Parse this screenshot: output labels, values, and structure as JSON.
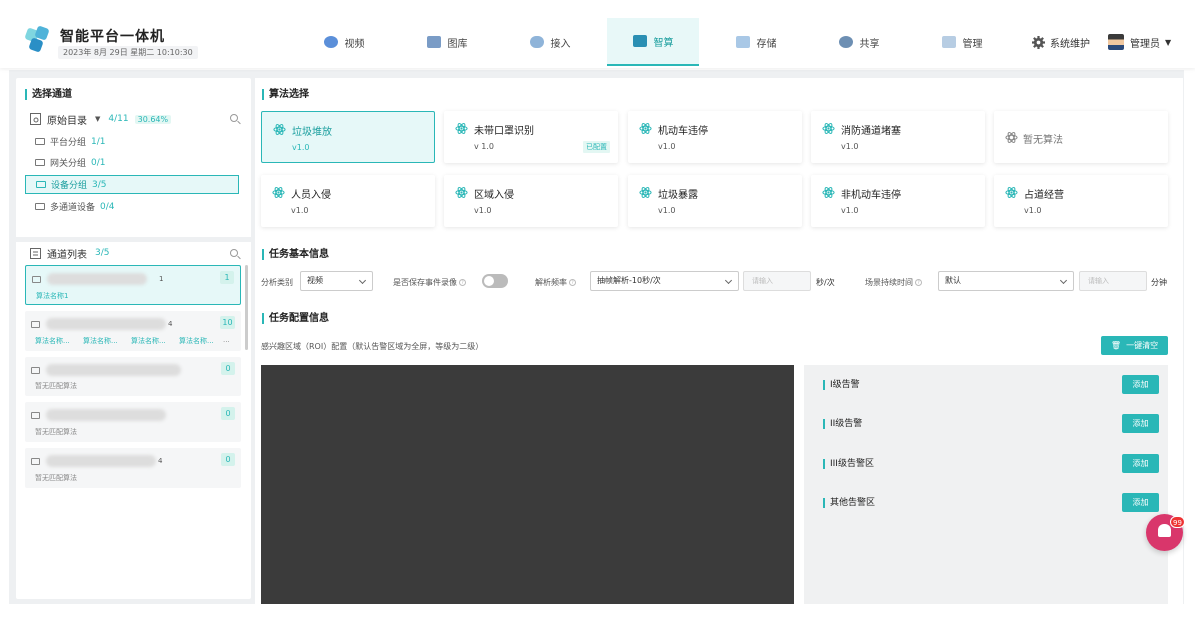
{
  "app": {
    "title": "智能平台一体机",
    "datetime": "2023年 8月 29日  星期二  10:10:30"
  },
  "nav": [
    {
      "label": "视频",
      "icon": "video-icon",
      "color": "#5b8fd9"
    },
    {
      "label": "图库",
      "icon": "gallery-icon",
      "color": "#7a9cc6"
    },
    {
      "label": "接入",
      "icon": "access-icon",
      "color": "#8fb4d9"
    },
    {
      "label": "智算",
      "icon": "compute-icon",
      "color": "#2ab7b7"
    },
    {
      "label": "存储",
      "icon": "storage-icon",
      "color": "#a9c8e6"
    },
    {
      "label": "共享",
      "icon": "share-icon",
      "color": "#6d8fb3"
    },
    {
      "label": "管理",
      "icon": "manage-icon",
      "color": "#b7cde3"
    }
  ],
  "header": {
    "sysmaint": "系统维护",
    "admin": "管理员"
  },
  "left": {
    "title": "选择通道",
    "root": {
      "label": "原始目录",
      "count": "4/11",
      "pct": "30.64%"
    },
    "groups": [
      {
        "label": "平台分组",
        "count": "1/1"
      },
      {
        "label": "网关分组",
        "count": "0/1"
      },
      {
        "label": "设备分组",
        "count": "3/5"
      },
      {
        "label": "多通道设备",
        "count": "0/4"
      }
    ],
    "list_title": "通道列表",
    "list_count": "3/5",
    "channels": [
      {
        "suffix": "1",
        "badge": "1",
        "sub": "算法名称1"
      },
      {
        "suffix": "4",
        "badge": "10",
        "tags": [
          "算法名称...",
          "算法名称...",
          "算法名称...",
          "算法名称...",
          "..."
        ]
      },
      {
        "suffix": "",
        "badge": "0",
        "sub": "暂无匹配算法"
      },
      {
        "suffix": "",
        "badge": "0",
        "sub": "暂无匹配算法"
      },
      {
        "suffix": "4",
        "badge": "0",
        "sub": "暂无匹配算法"
      }
    ]
  },
  "algo": {
    "title": "算法选择",
    "items": [
      {
        "name": "垃圾堆放",
        "ver": "v1.0"
      },
      {
        "name": "未带口罩识别",
        "ver": "v 1.0",
        "tag": "已配置"
      },
      {
        "name": "机动车违停",
        "ver": "v1.0"
      },
      {
        "name": "消防通道堵塞",
        "ver": "v1.0"
      },
      {
        "name": "暂无算法"
      },
      {
        "name": "人员入侵",
        "ver": "v1.0"
      },
      {
        "name": "区域入侵",
        "ver": "v1.0"
      },
      {
        "name": "垃圾暴露",
        "ver": "v1.0"
      },
      {
        "name": "非机动车违停",
        "ver": "v1.0"
      },
      {
        "name": "占道经营",
        "ver": "v1.0"
      }
    ]
  },
  "task": {
    "title": "任务基本信息",
    "type_label": "分析类别",
    "type_value": "视频",
    "save_label": "是否保存事件录像",
    "freq_label": "解析频率",
    "freq_value": "抽帧解析-10秒/次",
    "freq_placeholder": "请输入",
    "freq_unit": "秒/次",
    "dur_label": "场景持续时间",
    "dur_value": "默认",
    "dur_placeholder": "请输入",
    "dur_unit": "分钟"
  },
  "config": {
    "title": "任务配置信息",
    "desc": "感兴趣区域（ROI）配置（默认告警区域为全屏，等级为二级）",
    "clear": "一键清空",
    "alarms": [
      "I级告警",
      "II级告警",
      "III级告警区",
      "其他告警区"
    ],
    "add": "添加"
  },
  "notify": {
    "count": "99"
  }
}
